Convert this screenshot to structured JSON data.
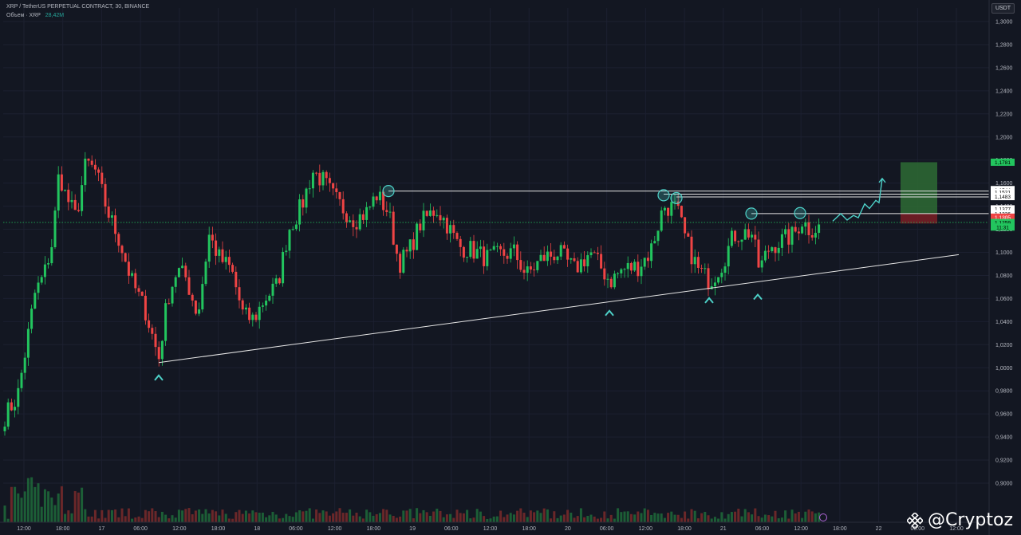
{
  "legend": {
    "symbol_title": "XRP / TetherUS PERPETUAL CONTRACT, 30, BINANCE",
    "volume_label": "Объем · XRP",
    "volume_value": "28,42M"
  },
  "currency_button": "USDT",
  "watermark": "@Cryptoz",
  "colors": {
    "background": "#131722",
    "up": "#22c55e",
    "down": "#ef4444",
    "line": "#e6e6e6",
    "annotation": "#4dd0c7",
    "tp_zone": "#2e6b34",
    "sl_zone": "#7a1f25"
  },
  "chart_data": {
    "type": "candlestick",
    "title": "XRP / TetherUS PERPETUAL CONTRACT, 30, BINANCE",
    "interval": "30",
    "y_ticks": [
      "1,3000",
      "1,2800",
      "1,2600",
      "1,2400",
      "1,2200",
      "1,2000",
      "1,1800",
      "1,1600",
      "1,1400",
      "1,1200",
      "1,1000",
      "1,0800",
      "1,0600",
      "1,0400",
      "1,0200",
      "1,0000",
      "0,9800",
      "0,9600",
      "0,9400",
      "0,9200",
      "0,9000"
    ],
    "x_ticks": [
      "12:00",
      "18:00",
      "17",
      "06:00",
      "12:00",
      "18:00",
      "18",
      "06:00",
      "12:00",
      "18:00",
      "19",
      "06:00",
      "12:00",
      "18:00",
      "20",
      "06:00",
      "12:00",
      "18:00",
      "21",
      "06:00",
      "12:00",
      "18:00",
      "22",
      "06:00",
      "12:00"
    ],
    "ylim": [
      0.885,
      1.305
    ],
    "price_labels": [
      {
        "text": "1,1781",
        "value": 1.1781,
        "bg": "#22c55e",
        "fg": "#000000"
      },
      {
        "text": "1,1544",
        "value": 1.1544,
        "bg": "#ffffff",
        "fg": "#000000"
      },
      {
        "text": "1,1521",
        "value": 1.1521,
        "bg": "#ffffff",
        "fg": "#000000"
      },
      {
        "text": "1,1483",
        "value": 1.1483,
        "bg": "#ffffff",
        "fg": "#000000"
      },
      {
        "text": "1,1377",
        "value": 1.1377,
        "bg": "#ffffff",
        "fg": "#000000"
      },
      {
        "text": "1,1336",
        "value": 1.1336,
        "bg": "#ffffff",
        "fg": "#000000"
      },
      {
        "text": "1,1305",
        "value": 1.1305,
        "bg": "#ef4444",
        "fg": "#ffffff"
      },
      {
        "text": "1,1259",
        "value": 1.1259,
        "bg": "#22c55e",
        "fg": "#000000"
      },
      {
        "text": "11:31",
        "value": 1.1219,
        "bg": "#22c55e",
        "fg": "#000000"
      }
    ],
    "current_price": 1.1259,
    "trendline": {
      "x": [
        199,
        1202
      ],
      "y": [
        1.0045,
        1.098
      ]
    },
    "resistance_lines": [
      {
        "x": [
          487,
          1240
        ],
        "y": 1.1531
      },
      {
        "x": [
          832,
          1240
        ],
        "y": 1.1504
      },
      {
        "x": [
          848,
          1240
        ],
        "y": 1.148
      },
      {
        "x": [
          942,
          1240
        ],
        "y": 1.1336
      }
    ],
    "touch_circles": [
      {
        "x": 487,
        "y": 1.1531
      },
      {
        "x": 832,
        "y": 1.1495
      },
      {
        "x": 848,
        "y": 1.147
      },
      {
        "x": 942,
        "y": 1.1336
      },
      {
        "x": 1003,
        "y": 1.134
      }
    ],
    "support_markers": [
      {
        "x": 199,
        "y": 0.992
      },
      {
        "x": 764,
        "y": 1.048
      },
      {
        "x": 889,
        "y": 1.059
      },
      {
        "x": 950,
        "y": 1.062
      }
    ],
    "projection_path": {
      "x": [
        1044,
        1054,
        1062,
        1070,
        1076,
        1084,
        1090,
        1098,
        1102,
        1106
      ],
      "y": [
        1.127,
        1.1335,
        1.128,
        1.132,
        1.13,
        1.142,
        1.138,
        1.145,
        1.143,
        1.164
      ]
    },
    "position_zone": {
      "x": [
        1129,
        1175
      ],
      "tp_top": 1.1781,
      "entry": 1.1336,
      "sl": 1.125
    },
    "pattern_anchors": [
      {
        "x": 6,
        "y": 0.958
      },
      {
        "x": 22,
        "y": 0.975
      },
      {
        "x": 32,
        "y": 1.015
      },
      {
        "x": 44,
        "y": 1.065
      },
      {
        "x": 55,
        "y": 1.08
      },
      {
        "x": 66,
        "y": 1.11
      },
      {
        "x": 74,
        "y": 1.17
      },
      {
        "x": 82,
        "y": 1.15
      },
      {
        "x": 95,
        "y": 1.13
      },
      {
        "x": 108,
        "y": 1.178
      },
      {
        "x": 120,
        "y": 1.17
      },
      {
        "x": 135,
        "y": 1.135
      },
      {
        "x": 150,
        "y": 1.11
      },
      {
        "x": 165,
        "y": 1.075
      },
      {
        "x": 182,
        "y": 1.05
      },
      {
        "x": 199,
        "y": 1.008
      },
      {
        "x": 210,
        "y": 1.06
      },
      {
        "x": 222,
        "y": 1.085
      },
      {
        "x": 233,
        "y": 1.078
      },
      {
        "x": 248,
        "y": 1.045
      },
      {
        "x": 262,
        "y": 1.115
      },
      {
        "x": 275,
        "y": 1.095
      },
      {
        "x": 290,
        "y": 1.085
      },
      {
        "x": 305,
        "y": 1.045
      },
      {
        "x": 318,
        "y": 1.042
      },
      {
        "x": 332,
        "y": 1.06
      },
      {
        "x": 348,
        "y": 1.072
      },
      {
        "x": 362,
        "y": 1.12
      },
      {
        "x": 378,
        "y": 1.14
      },
      {
        "x": 392,
        "y": 1.17
      },
      {
        "x": 405,
        "y": 1.162
      },
      {
        "x": 418,
        "y": 1.148
      },
      {
        "x": 430,
        "y": 1.138
      },
      {
        "x": 445,
        "y": 1.128
      },
      {
        "x": 460,
        "y": 1.135
      },
      {
        "x": 472,
        "y": 1.15
      },
      {
        "x": 487,
        "y": 1.135
      },
      {
        "x": 500,
        "y": 1.09
      },
      {
        "x": 512,
        "y": 1.1
      },
      {
        "x": 527,
        "y": 1.125
      },
      {
        "x": 547,
        "y": 1.138
      },
      {
        "x": 560,
        "y": 1.125
      },
      {
        "x": 575,
        "y": 1.105
      },
      {
        "x": 592,
        "y": 1.102
      },
      {
        "x": 610,
        "y": 1.095
      },
      {
        "x": 628,
        "y": 1.098
      },
      {
        "x": 645,
        "y": 1.1
      },
      {
        "x": 660,
        "y": 1.08
      },
      {
        "x": 680,
        "y": 1.095
      },
      {
        "x": 700,
        "y": 1.1
      },
      {
        "x": 720,
        "y": 1.085
      },
      {
        "x": 740,
        "y": 1.1
      },
      {
        "x": 755,
        "y": 1.085
      },
      {
        "x": 765,
        "y": 1.075
      },
      {
        "x": 780,
        "y": 1.085
      },
      {
        "x": 800,
        "y": 1.088
      },
      {
        "x": 815,
        "y": 1.1
      },
      {
        "x": 832,
        "y": 1.14
      },
      {
        "x": 848,
        "y": 1.138
      },
      {
        "x": 860,
        "y": 1.11
      },
      {
        "x": 875,
        "y": 1.085
      },
      {
        "x": 890,
        "y": 1.075
      },
      {
        "x": 905,
        "y": 1.09
      },
      {
        "x": 920,
        "y": 1.115
      },
      {
        "x": 942,
        "y": 1.118
      },
      {
        "x": 952,
        "y": 1.085
      },
      {
        "x": 965,
        "y": 1.105
      },
      {
        "x": 980,
        "y": 1.11
      },
      {
        "x": 995,
        "y": 1.115
      },
      {
        "x": 1005,
        "y": 1.128
      },
      {
        "x": 1015,
        "y": 1.12
      },
      {
        "x": 1030,
        "y": 1.122
      }
    ],
    "volume_ylim": [
      0,
      1
    ]
  }
}
